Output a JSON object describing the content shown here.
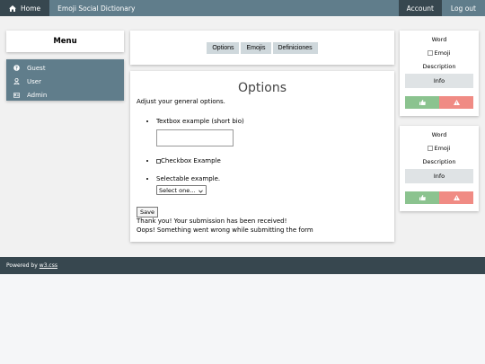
{
  "nav": {
    "home": "Home",
    "title": "Emoji Social Dictionary",
    "account": "Account",
    "logout": "Log out"
  },
  "sidebar": {
    "heading": "Menu",
    "items": [
      {
        "label": "Guest",
        "icon": "question-circle-icon"
      },
      {
        "label": "User",
        "icon": "user-icon"
      },
      {
        "label": "Admin",
        "icon": "id-card-icon"
      }
    ]
  },
  "tabs": [
    "Options",
    "Emojis",
    "Definiciones"
  ],
  "options": {
    "title": "Options",
    "intro": "Adjust your general options.",
    "textbox_label": "Textbox example (short bio)",
    "checkbox_label": "Checkbox Example",
    "select_label": "Selectable example.",
    "select_value": "Select one...",
    "save": "Save",
    "success": "Thank you! Your submission has been received!",
    "error": "Oops! Something went wrong while submitting the form"
  },
  "cards": [
    {
      "word": "Word",
      "emoji_alt": "Emoji",
      "description": "Description",
      "info": "Info"
    },
    {
      "word": "Word",
      "emoji_alt": "Emoji",
      "description": "Description",
      "info": "Info"
    }
  ],
  "footer": {
    "prefix": "Powered by",
    "link": "w3.css"
  },
  "colors": {
    "nav": "#607d8b",
    "dark": "#37474f",
    "like": "#8bc38f",
    "report": "#f08b84"
  }
}
